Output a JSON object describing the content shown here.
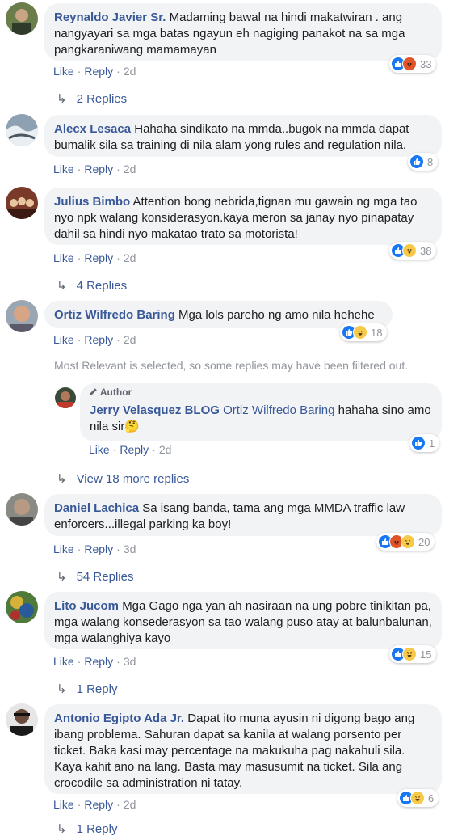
{
  "actions": {
    "like": "Like",
    "reply": "Reply"
  },
  "comments": [
    {
      "name": "Reynaldo Javier Sr.",
      "text": "Madaming bawal na hindi makatwiran . ang nangyayari sa mga batas ngayun eh nagiging panakot na sa mga pangkaraniwang mamamayan",
      "time": "2d",
      "reactions": {
        "icons": [
          "like",
          "angry"
        ],
        "count": "33"
      },
      "replies": "2 Replies"
    },
    {
      "name": "Alecx Lesaca",
      "text": "Hahaha sindikato na mmda..bugok na mmda dapat bumalik sila sa training di nila alam yong rules and regulation nila.",
      "time": "2d",
      "reactions": {
        "icons": [
          "like"
        ],
        "count": "8"
      }
    },
    {
      "name": "Julius Bimbo",
      "text": "Attention bong nebrida,tignan mu gawain ng mga tao nyo npk walang konsiderasyon.kaya meron sa janay nyo pinapatay dahil sa hindi nyo makatao trato sa motorista!",
      "time": "2d",
      "reactions": {
        "icons": [
          "like",
          "wow"
        ],
        "count": "38"
      },
      "replies": "4 Replies"
    },
    {
      "name": "Ortiz Wilfredo Baring",
      "text": "Mga lols pareho ng amo nila hehehe",
      "time": "2d",
      "reactions": {
        "icons": [
          "like",
          "haha"
        ],
        "count": "18"
      }
    },
    {
      "name": "Daniel Lachica",
      "text": "Sa isang banda, tama ang mga MMDA traffic law enforcers...illegal parking ka boy!",
      "time": "3d",
      "reactions": {
        "icons": [
          "like",
          "angry",
          "haha"
        ],
        "count": "20"
      },
      "replies": "54 Replies"
    },
    {
      "name": "Lito Jucom",
      "text": "Mga Gago nga yan ah nasiraan na ung pobre tinikitan pa, mga walang konsederasyon sa tao walang puso atay at balunbalunan, mga walanghiya kayo",
      "time": "3d",
      "reactions": {
        "icons": [
          "like",
          "haha"
        ],
        "count": "15"
      },
      "replies": "1 Reply"
    },
    {
      "name": "Antonio Egipto Ada Jr.",
      "text": "Dapat ito muna ayusin ni digong bago ang ibang problema. Sahuran dapat sa kanila at walang porsento per ticket. Baka kasi may percentage na makukuha pag nakahuli sila. Kaya kahit ano na lang. Basta may masusumit na ticket. Sila ang crocodile sa administration ni tatay.",
      "time": "2d",
      "reactions": {
        "icons": [
          "like",
          "haha"
        ],
        "count": "6"
      }
    }
  ],
  "notice": "Most Relevant is selected, so some replies may have been filtered out.",
  "nested_reply": {
    "badge": "Author",
    "name": "Jerry Velasquez BLOG",
    "mention": "Ortiz Wilfredo Baring",
    "text": "hahaha sino amo nila sir",
    "emoji": "🤔",
    "time": "2d",
    "reactions": {
      "icons": [
        "like"
      ],
      "count": "1"
    }
  },
  "view_more": "View 18 more replies",
  "partial_bottom": "1 Reply"
}
